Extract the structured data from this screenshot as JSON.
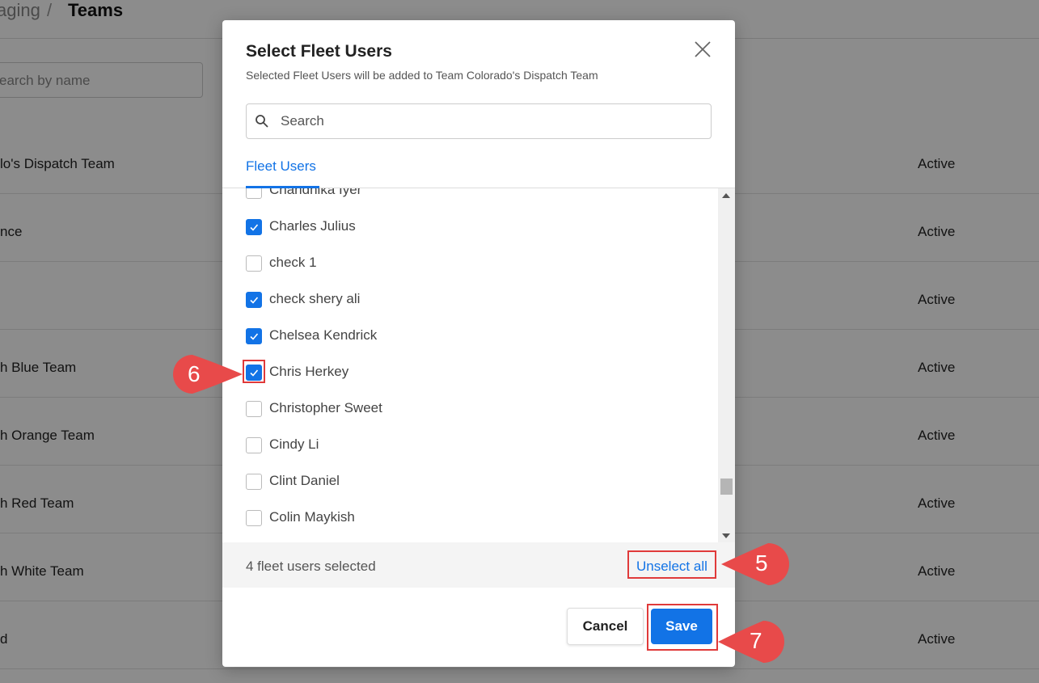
{
  "background": {
    "breadcrumb": {
      "parent": "aging",
      "separator": "/",
      "current": "Teams"
    },
    "search_placeholder": "earch by name",
    "rows": [
      {
        "name": "lo's Dispatch Team",
        "status": "Active"
      },
      {
        "name": "nce",
        "status": "Active"
      },
      {
        "name": "",
        "status": "Active"
      },
      {
        "name": "h Blue Team",
        "status": "Active"
      },
      {
        "name": "h Orange Team",
        "status": "Active"
      },
      {
        "name": "h Red Team",
        "status": "Active"
      },
      {
        "name": "h White Team",
        "status": "Active"
      },
      {
        "name": "d",
        "status": "Active"
      }
    ]
  },
  "modal": {
    "title": "Select Fleet Users",
    "subtitle": "Selected Fleet Users will be added to Team Colorado's Dispatch Team",
    "search_placeholder": "Search",
    "tab_label": "Fleet Users",
    "users": [
      {
        "name": "Chandhika Iyer",
        "checked": false
      },
      {
        "name": "Charles Julius",
        "checked": true
      },
      {
        "name": "check 1",
        "checked": false
      },
      {
        "name": "check shery ali",
        "checked": true
      },
      {
        "name": "Chelsea Kendrick",
        "checked": true
      },
      {
        "name": "Chris Herkey",
        "checked": true
      },
      {
        "name": "Christopher Sweet",
        "checked": false
      },
      {
        "name": "Cindy Li",
        "checked": false
      },
      {
        "name": "Clint Daniel",
        "checked": false
      },
      {
        "name": "Colin Maykish",
        "checked": false
      }
    ],
    "selected_count_text": "4 fleet users selected",
    "unselect_all_label": "Unselect all",
    "cancel_label": "Cancel",
    "save_label": "Save"
  },
  "annotations": {
    "step_unselect": "5",
    "step_checkbox": "6",
    "step_save": "7",
    "color": "#e84a4a"
  },
  "colors": {
    "accent": "#1273e6",
    "overlay": "rgba(0,0,0,0.45)"
  },
  "icons": {
    "close": "close-icon",
    "search": "search-icon",
    "check": "check-icon"
  }
}
